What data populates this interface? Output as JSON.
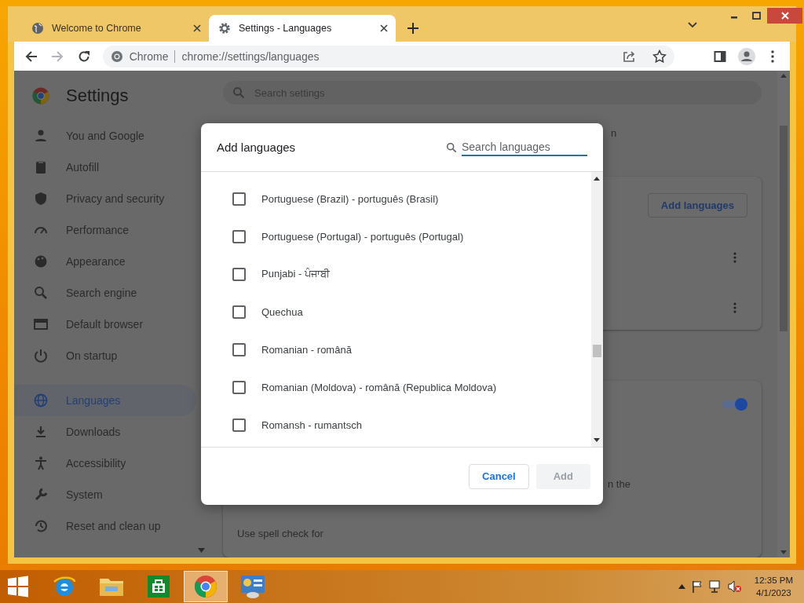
{
  "tabs": [
    {
      "title": "Welcome to Chrome",
      "selected": false
    },
    {
      "title": "Settings - Languages",
      "selected": true
    }
  ],
  "omnibox": {
    "site_label": "Chrome",
    "url": "chrome://settings/languages"
  },
  "settings": {
    "title": "Settings",
    "search": {
      "placeholder": "Search settings"
    },
    "nav": [
      {
        "label": "You and Google",
        "selected": false
      },
      {
        "label": "Autofill",
        "selected": false
      },
      {
        "label": "Privacy and security",
        "selected": false
      },
      {
        "label": "Performance",
        "selected": false
      },
      {
        "label": "Appearance",
        "selected": false
      },
      {
        "label": "Search engine",
        "selected": false
      },
      {
        "label": "Default browser",
        "selected": false
      },
      {
        "label": "On startup",
        "selected": false
      },
      {
        "label": "Languages",
        "selected": true
      },
      {
        "label": "Downloads",
        "selected": false
      },
      {
        "label": "Accessibility",
        "selected": false
      },
      {
        "label": "System",
        "selected": false
      },
      {
        "label": "Reset and clean up",
        "selected": false
      }
    ],
    "top_fragment": "n",
    "add_languages_button": "Add languages",
    "spell_toggle": {
      "on": true
    },
    "spell_fragment": "n the",
    "spell_check_for": "Use spell check for"
  },
  "dialog": {
    "title": "Add languages",
    "search": {
      "placeholder": "Search languages"
    },
    "languages": [
      {
        "label": "Portuguese (Brazil) - português (Brasil)",
        "checked": false
      },
      {
        "label": "Portuguese (Portugal) - português (Portugal)",
        "checked": false
      },
      {
        "label": "Punjabi - ਪੰਜਾਬੀ",
        "checked": false
      },
      {
        "label": "Quechua",
        "checked": false
      },
      {
        "label": "Romanian - română",
        "checked": false
      },
      {
        "label": "Romanian (Moldova) - română (Republica Moldova)",
        "checked": false
      },
      {
        "label": "Romansh - rumantsch",
        "checked": false
      }
    ],
    "cancel_button": "Cancel",
    "add_button": {
      "label": "Add",
      "disabled": true
    }
  },
  "taskbar": {
    "apps": [
      {
        "kind": "ie",
        "selected": false
      },
      {
        "kind": "explorer",
        "selected": false
      },
      {
        "kind": "store",
        "selected": false
      },
      {
        "kind": "chrome",
        "selected": true
      },
      {
        "kind": "control-panel",
        "selected": false
      }
    ],
    "time": "12:35 PM",
    "date": "4/1/2023"
  }
}
